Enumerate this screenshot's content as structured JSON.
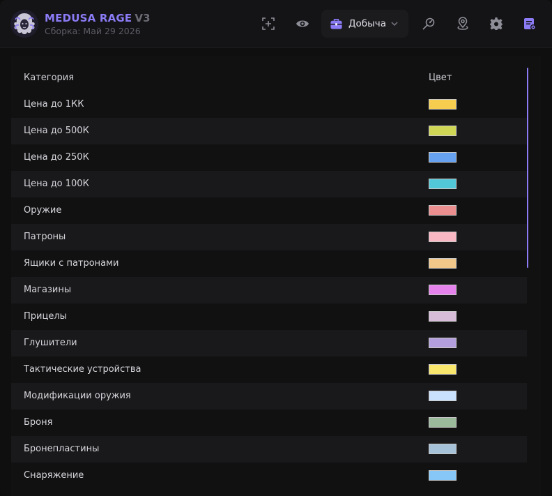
{
  "app": {
    "name": "MEDUSA RAGE",
    "version": "V3",
    "build": "Сборка: Май 29 2026"
  },
  "toolbar": {
    "dropdown_label": "Добыча",
    "icons": [
      "crosshair-icon",
      "eye-icon",
      "briefcase-icon",
      "radar-search-icon",
      "location-pin-icon",
      "gear-icon",
      "notes-settings-icon"
    ]
  },
  "colors": {
    "accent": "#8b7cf6"
  },
  "table": {
    "headers": {
      "category": "Категория",
      "color": "Цвет"
    },
    "rows": [
      {
        "name": "Цена до 1КК",
        "color": "#f7cd4f"
      },
      {
        "name": "Цена до 500К",
        "color": "#cfd655"
      },
      {
        "name": "Цена до 250К",
        "color": "#66a2ef"
      },
      {
        "name": "Цена до 100К",
        "color": "#52c7d8"
      },
      {
        "name": "Оружие",
        "color": "#ec8f90"
      },
      {
        "name": "Патроны",
        "color": "#f9b7c4"
      },
      {
        "name": "Ящики с патронами",
        "color": "#f1c88a"
      },
      {
        "name": "Магазины",
        "color": "#e682ec"
      },
      {
        "name": "Прицелы",
        "color": "#d8bdd9"
      },
      {
        "name": "Глушители",
        "color": "#b49fde"
      },
      {
        "name": "Тактические устройства",
        "color": "#f9e66d"
      },
      {
        "name": "Модификации оружия",
        "color": "#c9e1fc"
      },
      {
        "name": "Броня",
        "color": "#9bb99b"
      },
      {
        "name": "Бронепластины",
        "color": "#a5c2d8"
      },
      {
        "name": "Снаряжение",
        "color": "#86c7f7"
      }
    ]
  }
}
